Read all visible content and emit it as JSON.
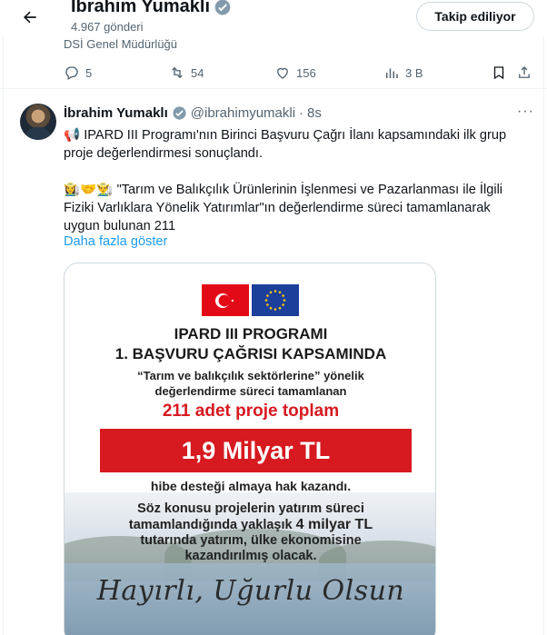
{
  "header": {
    "name": "İbrahim Yumaklı",
    "posts_count": "4.967 gönderi",
    "follow_label": "Takip ediliyor"
  },
  "prev_tweet": {
    "org": "DSİ Genel Müdürlüğü",
    "replies": "5",
    "retweets": "54",
    "likes": "156",
    "views": "3 B"
  },
  "tweet": {
    "name": "İbrahim Yumaklı",
    "handle": "@ibrahimyumakli",
    "dot": "·",
    "time": "8s",
    "more": "···",
    "line1": "📢 IPARD III Programı'nın Birinci Başvuru Çağrı İlanı kapsamındaki ilk grup",
    "line2": "proje değerlendirmesi sonuçlandı.",
    "line3": "👩‍🌾🤝👨‍🌾 \"Tarım ve Balıkçılık Ürünlerinin İşlenmesi ve Pazarlanması ile İlgili",
    "line4": "Fiziki Varlıklara Yönelik Yatırımlar\"ın değerlendirme süreci tamamlanarak",
    "line5": "uygun bulunan 211",
    "show_more": "Daha fazla göster"
  },
  "image": {
    "title1": "IPARD III PROGRAMI",
    "title2": "1. BAŞVURU ÇAĞRISI KAPSAMINDA",
    "sub1": "“Tarım ve balıkçılık sektörlerine” yönelik",
    "sub2": "değerlendirme süreci tamamlanan",
    "count": "211 adet proje toplam",
    "amount": "1,9 Milyar TL",
    "grant": "hibe desteği almaya hak kazandı.",
    "p1": "Söz konusu projelerin yatırım süreci",
    "p2a": "tamamlandığında yaklaşık ",
    "p2b": "4 milyar TL",
    "p3": "tutarında yatırım, ülke ekonomisine",
    "p4": "kazandırılmış olacak.",
    "slogan": "Hayırlı, Uğurlu Olsun"
  },
  "colors": {
    "accent": "#1d9bf0",
    "red": "#d71920",
    "eu_blue": "#1d3f9c"
  }
}
